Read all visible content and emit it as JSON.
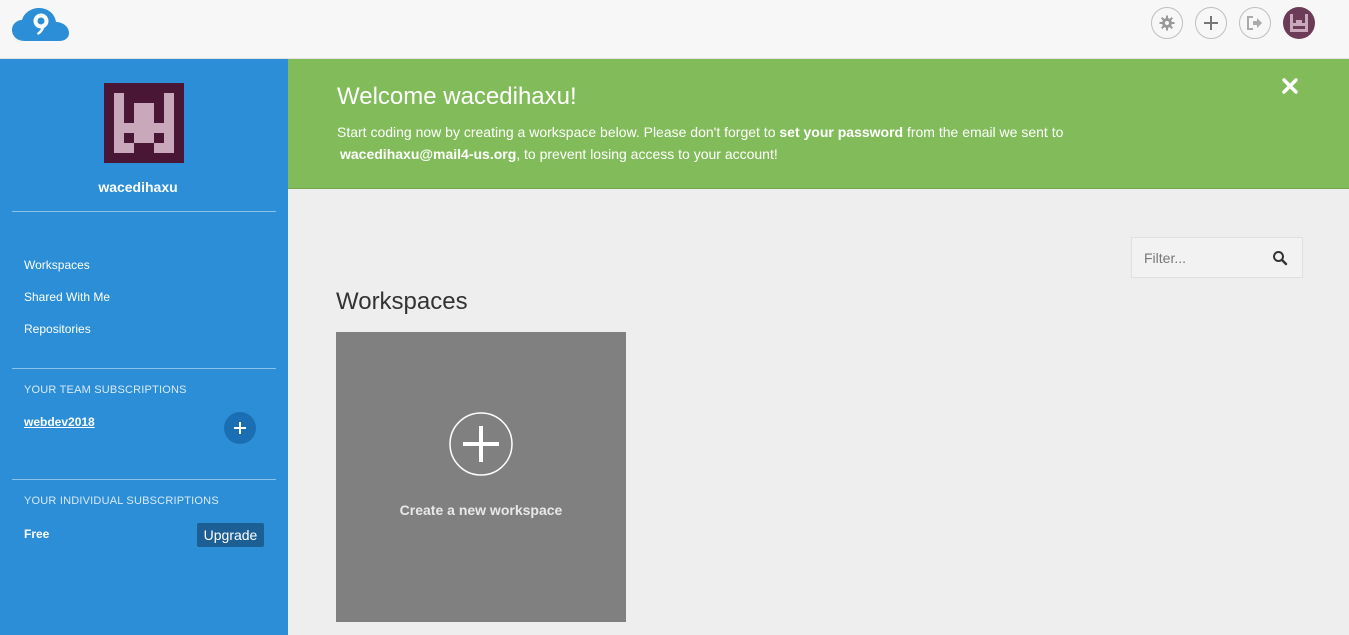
{
  "header": {
    "logo": "cloud9-logo",
    "icons": [
      "gear-icon",
      "plus-icon",
      "sign-out-icon",
      "avatar"
    ]
  },
  "sidebar": {
    "username": "wacedihaxu",
    "nav": [
      {
        "label": "Workspaces"
      },
      {
        "label": "Shared With Me"
      },
      {
        "label": "Repositories"
      }
    ],
    "team_section_label": "YOUR TEAM SUBSCRIPTIONS",
    "team_name": "webdev2018",
    "individual_section_label": "YOUR INDIVIDUAL SUBSCRIPTIONS",
    "plan": "Free",
    "upgrade_label": "Upgrade"
  },
  "banner": {
    "title": "Welcome wacedihaxu!",
    "text_1": "Start coding now by creating a workspace below. Please don't forget to ",
    "text_bold_1": "set your password",
    "text_2": " from the email we sent to",
    "email": "wacedihaxu@mail4-us.org",
    "text_3": ", to prevent losing access to your account!"
  },
  "main": {
    "filter_placeholder": "Filter...",
    "heading": "Workspaces",
    "create_label": "Create a new workspace"
  },
  "colors": {
    "sidebar": "#2b8ed6",
    "banner": "#82bc5a",
    "card": "#808080",
    "upgrade": "#1c5f94"
  }
}
